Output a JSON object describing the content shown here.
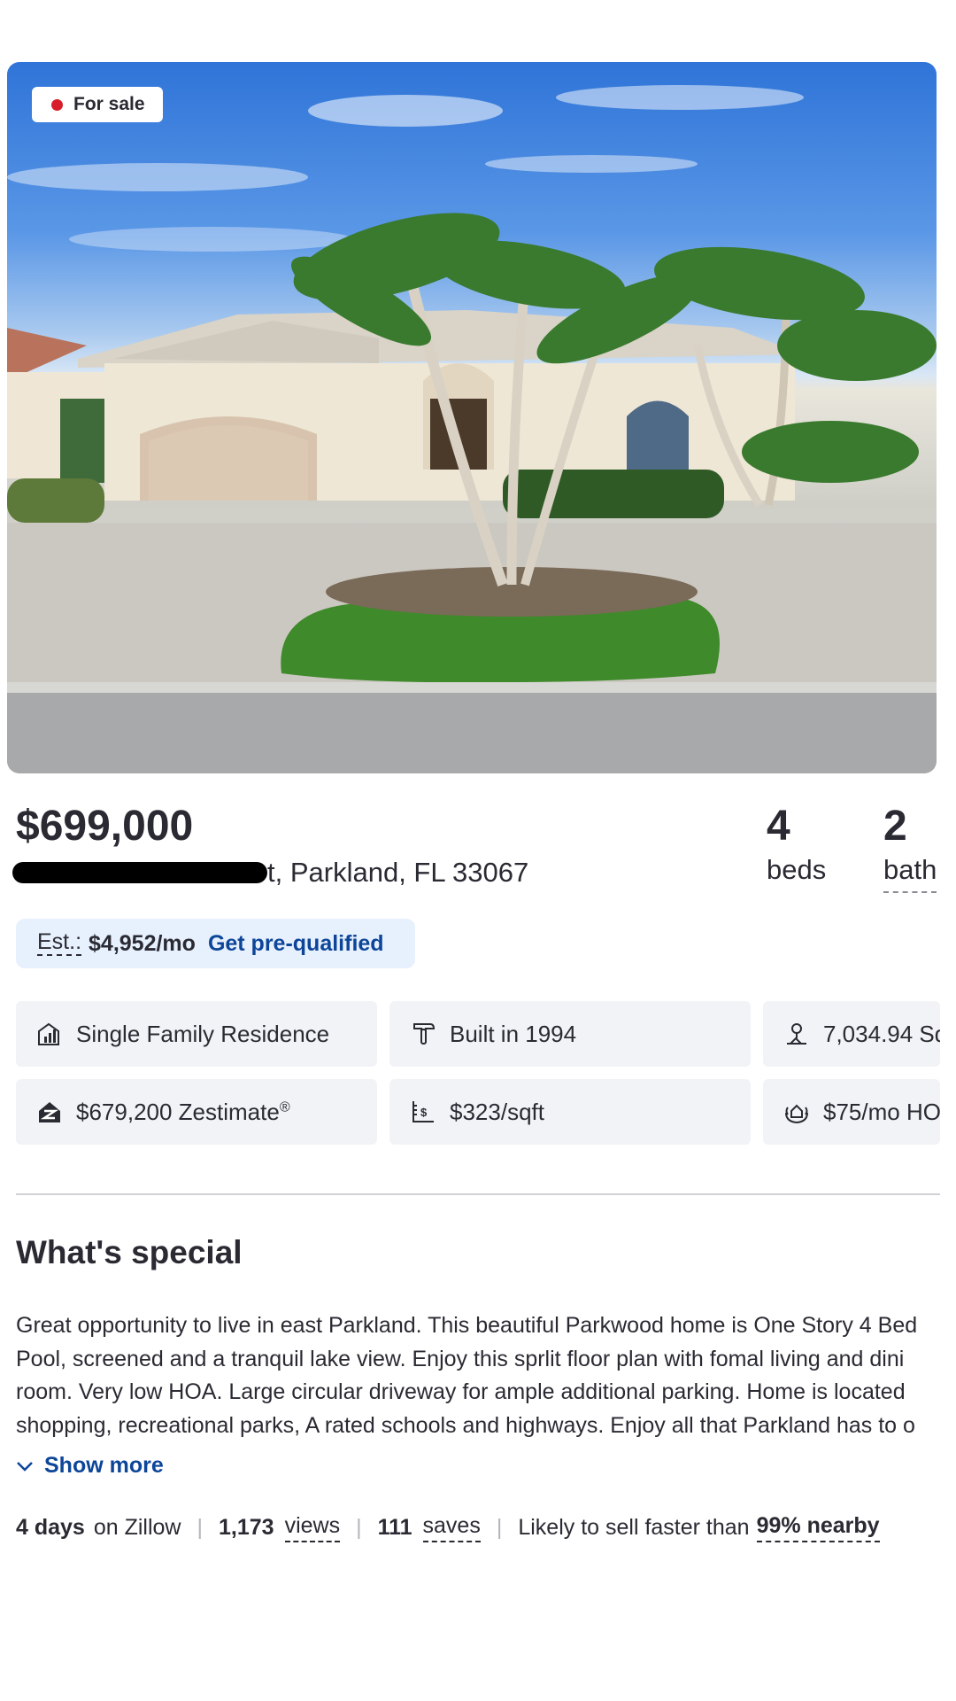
{
  "listing": {
    "status": "For sale",
    "price": "$699,000",
    "address_visible": "t, Parkland, FL 33067",
    "beds_value": "4",
    "beds_label": "beds",
    "baths_value": "2",
    "baths_label": "bath"
  },
  "estimate": {
    "label": "Est.:",
    "amount": "$4,952/mo",
    "cta": "Get pre-qualified"
  },
  "facts": [
    {
      "icon": "house-chart-icon",
      "text": "Single Family Residence"
    },
    {
      "icon": "hammer-icon",
      "text": "Built in 1994"
    },
    {
      "icon": "lot-size-icon",
      "text": "7,034.94 Sq"
    },
    {
      "icon": "zestimate-icon",
      "text": "$679,200 Zestimate",
      "sup": "®"
    },
    {
      "icon": "price-per-sqft-icon",
      "text": "$323/sqft"
    },
    {
      "icon": "hoa-icon",
      "text": "$75/mo HO"
    }
  ],
  "whats_special": {
    "title": "What's special",
    "lines": [
      "Great opportunity to live in east Parkland. This beautiful Parkwood home is One Story 4 Bed",
      "Pool, screened and a tranquil lake view. Enjoy this sprlit floor plan with fomal living and dini",
      "room. Very low HOA. Large circular driveway for ample additional parking. Home is located",
      "shopping, recreational parks, A rated schools and highways. Enjoy all that Parkland has to o"
    ],
    "show_more": "Show more"
  },
  "stats": {
    "days_value": "4 days",
    "days_suffix": "on Zillow",
    "views_value": "1,173",
    "views_label": "views",
    "saves_value": "111",
    "saves_label": "saves",
    "sell_text": "Likely to sell faster than",
    "sell_value": "99% nearby"
  },
  "colors": {
    "status_dot": "#d91e2b",
    "link": "#0d4599",
    "est_bg": "#e7f1fd",
    "card_bg": "#f2f3f7"
  }
}
